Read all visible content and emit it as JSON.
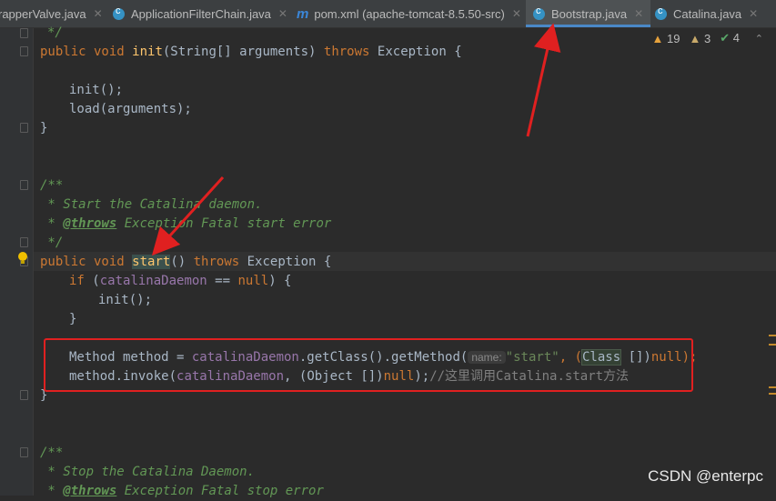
{
  "tabs": [
    {
      "label": "rapperValve.java",
      "icon": "none"
    },
    {
      "label": "ApplicationFilterChain.java",
      "icon": "java-class-icon"
    },
    {
      "label": "pom.xml (apache-tomcat-8.5.50-src)",
      "icon": "maven-icon"
    },
    {
      "label": "Bootstrap.java",
      "icon": "java-class-icon",
      "active": true
    },
    {
      "label": "Catalina.java",
      "icon": "java-class-icon"
    }
  ],
  "inspections": {
    "warnings": "19",
    "weak_warnings": "3",
    "typos": "4"
  },
  "code": {
    "l1": "*/",
    "l2_kw1": "public void ",
    "l2_fn": "init",
    "l2_rest": "(String[] arguments) ",
    "l2_kw2": "throws ",
    "l2_tail": "Exception {",
    "l3": "init();",
    "l4": "load(arguments);",
    "l5": "}",
    "d1": "/**",
    "d2": " * Start the Catalina daemon.",
    "d3_tag": "@throws",
    "d3_rest": " Exception Fatal start error",
    "d4": " */",
    "s_kw1": "public void ",
    "s_fn": "start",
    "s_rest": "() ",
    "s_kw2": "throws ",
    "s_tail": "Exception {",
    "if_kw": "if ",
    "if_open": "(",
    "if_fld": "catalinaDaemon",
    "if_eq": " == ",
    "if_null": "null",
    "if_close": ") {",
    "init2": "init();",
    "close_if": "}",
    "m1_a": "Method method = ",
    "m1_fld": "catalinaDaemon",
    "m1_b": ".getClass().getMethod(",
    "m1_hint": "name:",
    "m1_str": "\"start\"",
    "m1_c": ", (",
    "m1_cls": "Class",
    "m1_d": " [])",
    "m1_null": "null",
    "m1_e": ");",
    "m2_a": "method.invoke(",
    "m2_fld": "catalinaDaemon",
    "m2_b": ", (Object [])",
    "m2_null": "null",
    "m2_c": ");",
    "m2_cmt": "//这里调用Catalina.start方法",
    "close_method": "}",
    "e1": "/**",
    "e2": " * Stop the Catalina Daemon.",
    "e3_tag": "@throws",
    "e3_rest": " Exception Fatal stop error"
  },
  "watermark": "CSDN @enterpc"
}
